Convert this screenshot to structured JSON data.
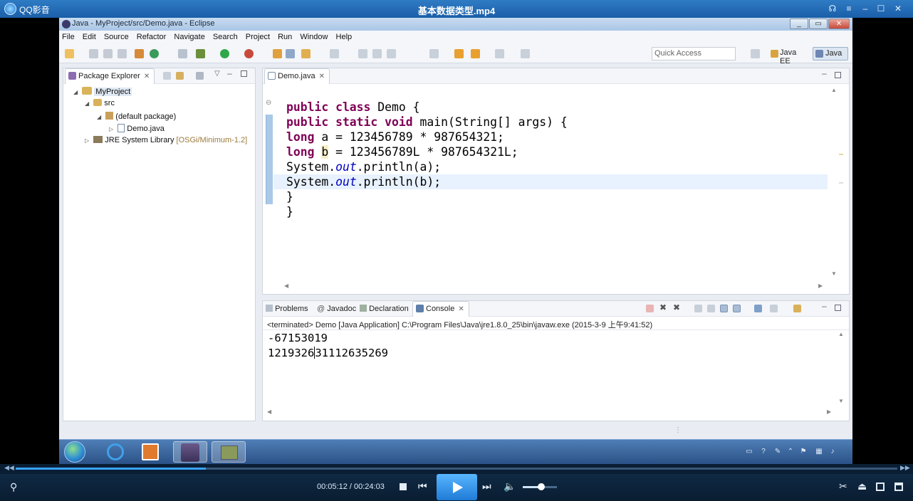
{
  "player": {
    "app_name": "QQ影音",
    "file_title": "基本数据类型.mp4",
    "current_time": "00:05:12",
    "total_time": "00:24:03",
    "time_separator": " / ",
    "progress": 0.216,
    "volume": 0.55,
    "title_buttons": [
      "headset-icon",
      "settings-icon",
      "minimize-icon",
      "maximize-icon",
      "close-icon"
    ]
  },
  "eclipse": {
    "window_title": "Java - MyProject/src/Demo.java - Eclipse",
    "menu": [
      "File",
      "Edit",
      "Source",
      "Refactor",
      "Navigate",
      "Search",
      "Project",
      "Run",
      "Window",
      "Help"
    ],
    "quick_access_placeholder": "Quick Access",
    "perspectives": {
      "javaee": "Java EE",
      "java": "Java"
    },
    "package_explorer": {
      "tab": "Package Explorer",
      "tree": {
        "project": "MyProject",
        "src": "src",
        "package": "(default package)",
        "file": "Demo.java",
        "jre": "JRE System Library",
        "jre_detail": "[OSGi/Minimum-1.2]"
      }
    },
    "editor": {
      "tab": "Demo.java",
      "code": {
        "l1_kw": "public class",
        "l1_rest": " Demo {",
        "l2_kw": "public static void",
        "l2_rest": " main(String[] args) {",
        "l3_kw": "long",
        "l3_rest": " a = 123456789 * 987654321;",
        "l4_kw": "long",
        "l4_var": "b",
        "l4_rest": " = 123456789L * 987654321L;",
        "l5_a": "System.",
        "l5_b": "out",
        "l5_c": ".println(a);",
        "l6_a": "System.",
        "l6_b": "out",
        "l6_c": ".println(b);",
        "l7": "}",
        "l8": "}"
      }
    },
    "bottom_tabs": {
      "problems": "Problems",
      "javadoc": "Javadoc",
      "declaration": "Declaration",
      "console": "Console"
    },
    "console": {
      "description": "<terminated> Demo [Java Application] C:\\Program Files\\Java\\jre1.8.0_25\\bin\\javaw.exe (2015-3-9 上午9:41:52)",
      "line1": "-67153019",
      "line2_a": "1219326",
      "line2_b": "31112635269"
    }
  },
  "colors": {
    "keyword": "#7f0055",
    "static_field": "#0000c0",
    "player_accent": "#2f7cc4",
    "taskbar": "#2b5287"
  }
}
